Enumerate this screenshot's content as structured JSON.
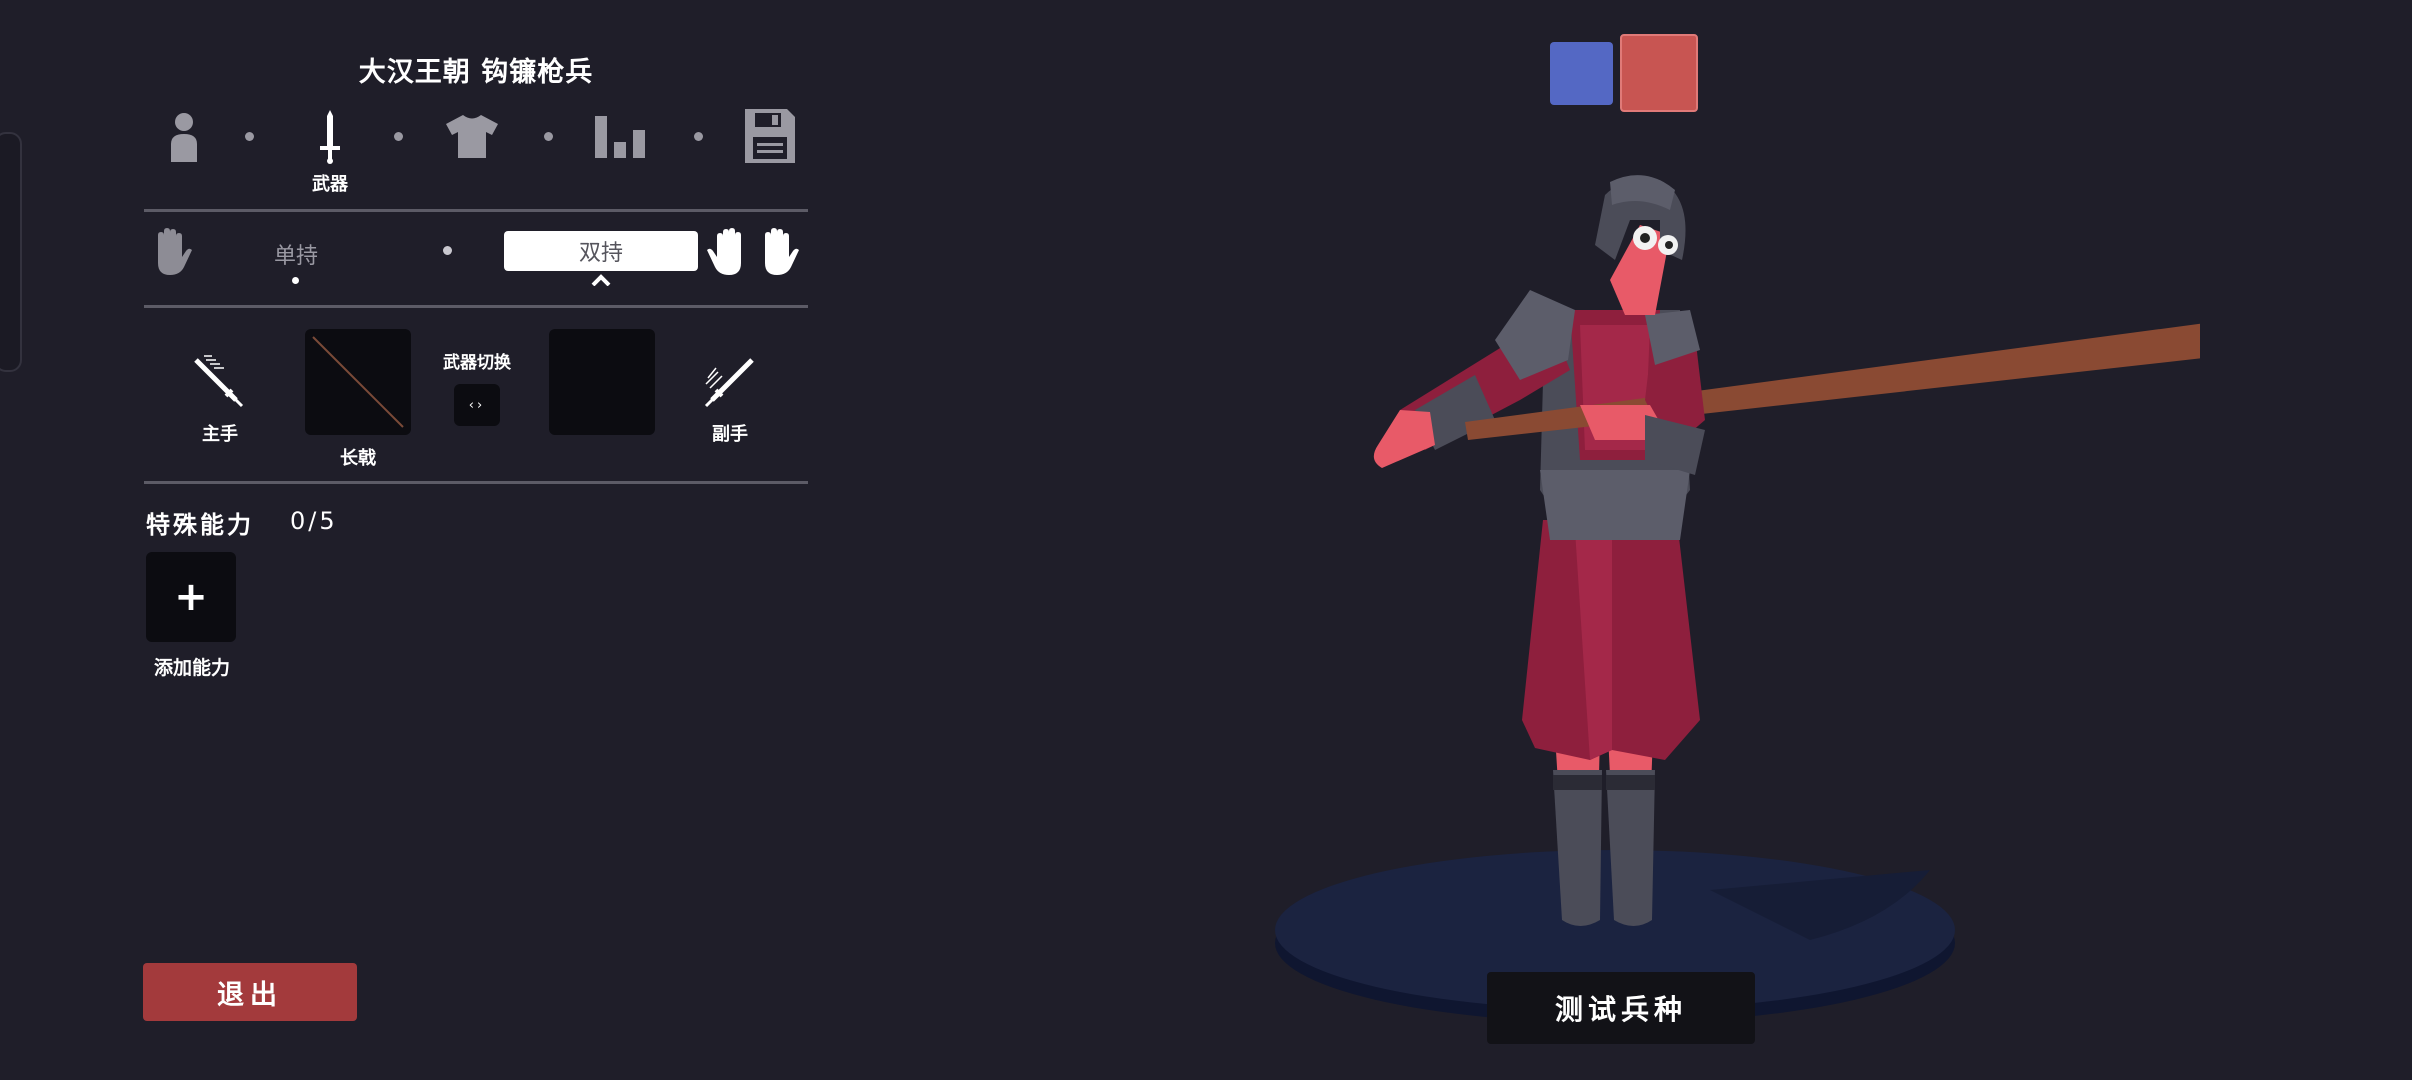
{
  "unit_title": "大汉王朝 钩镰枪兵",
  "steps": [
    {
      "icon": "person-icon",
      "label": ""
    },
    {
      "icon": "sword-icon",
      "label": "武器"
    },
    {
      "icon": "shirt-icon",
      "label": ""
    },
    {
      "icon": "bar-chart-icon",
      "label": ""
    },
    {
      "icon": "save-icon",
      "label": ""
    }
  ],
  "grip": {
    "single_label": "单持",
    "dual_label": "双持",
    "selected": "双持"
  },
  "weapons": {
    "main_hand_label": "主手",
    "main_weapon_name": "长戟",
    "switch_label": "武器切换",
    "off_hand_label": "副手"
  },
  "abilities": {
    "title": "特殊能力",
    "count": "0/5",
    "add_label": "添加能力"
  },
  "buttons": {
    "exit": "退出",
    "test_unit": "测试兵种"
  },
  "team_colors": {
    "blue": "#5468c4",
    "red": "#c85552"
  },
  "colors": {
    "background": "#1f1e29",
    "exit_button": "#a33a3c",
    "armor_gray": "#4b4c58",
    "cloth_crimson": "#8e1f3d"
  }
}
